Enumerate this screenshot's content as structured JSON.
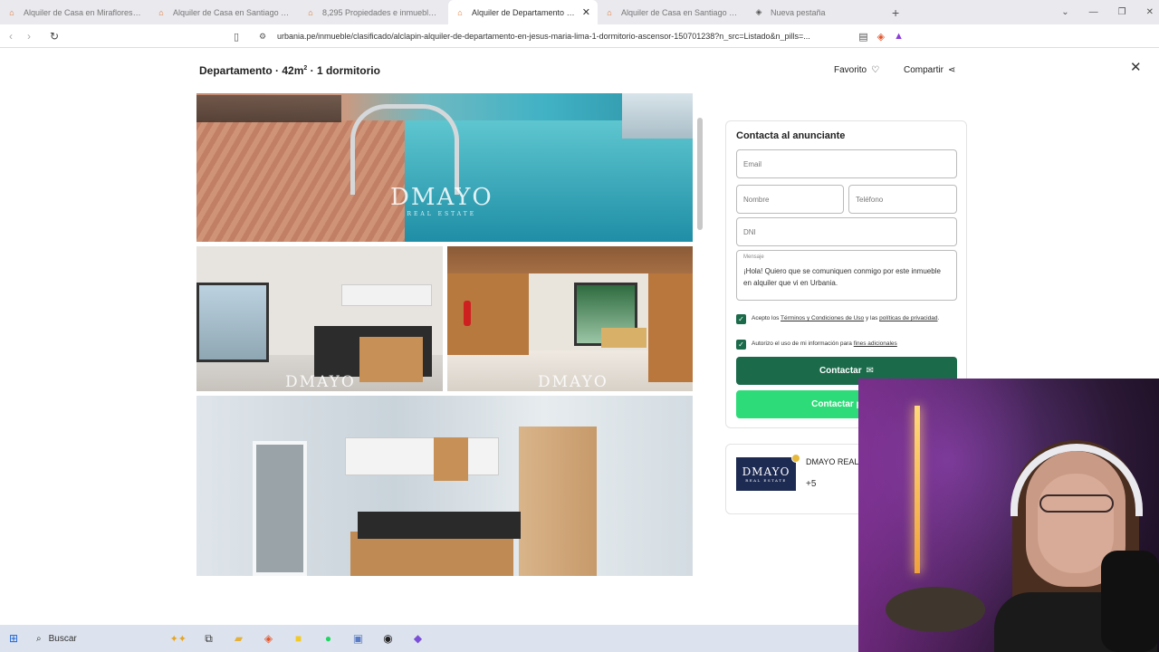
{
  "browser": {
    "tabs": [
      {
        "title": "Alquiler de Casa en Miraflores - Lima",
        "active": false,
        "icon": "urbania-icon"
      },
      {
        "title": "Alquiler de Casa en Santiago de Surco",
        "active": false,
        "icon": "urbania-icon"
      },
      {
        "title": "8,295 Propiedades e inmuebles en al",
        "active": false,
        "icon": "urbania-icon"
      },
      {
        "title": "Alquiler de Departamento en Jes",
        "active": true,
        "icon": "urbania-icon"
      },
      {
        "title": "Alquiler de Casa en Santiago de Surco",
        "active": false,
        "icon": "urbania-icon"
      },
      {
        "title": "Nueva pestaña",
        "active": false,
        "icon": "brave-shield-icon"
      }
    ],
    "url": "urbania.pe/inmueble/clasificado/alclapin-alquiler-de-departamento-en-jesus-maria-lima-1-dormitorio-ascensor-150701238?n_src=Listado&n_pills=..."
  },
  "listing": {
    "title": "Departamento · 42m",
    "title_sup": "2",
    "title_rest": " · 1 dormitorio",
    "favorite_label": "Favorito",
    "share_label": "Compartir",
    "watermark": "DMAYO",
    "watermark_sub": "REAL ESTATE"
  },
  "contact": {
    "heading": "Contacta al anunciante",
    "email_placeholder": "Email",
    "name_placeholder": "Nombre",
    "phone_placeholder": "Teléfono",
    "dni_placeholder": "DNI",
    "message_label": "Mensaje",
    "message_value": "¡Hola! Quiero que se comuniquen conmigo por este inmueble en alquiler que vi en Urbania.",
    "terms_prefix": "Acepto los ",
    "terms_link": "Términos y Condiciones de Uso",
    "terms_mid": " y las ",
    "privacy_link": "políticas de privacidad",
    "terms_suffix": ".",
    "authorize_prefix": "Autorizo el uso de mi información para ",
    "authorize_link": "fines adicionales",
    "contact_button": "Contactar",
    "whatsapp_button": "Contactar por W"
  },
  "agency": {
    "logo_text": "DMAYO",
    "logo_sub": "REAL ESTATE",
    "name": "DMAYO REAL",
    "count": "+5"
  },
  "taskbar": {
    "search_label": "Buscar"
  },
  "colors": {
    "primary_green": "#1b6b4b",
    "whatsapp_green": "#2ddc78",
    "agency_navy": "#1d2a52"
  }
}
